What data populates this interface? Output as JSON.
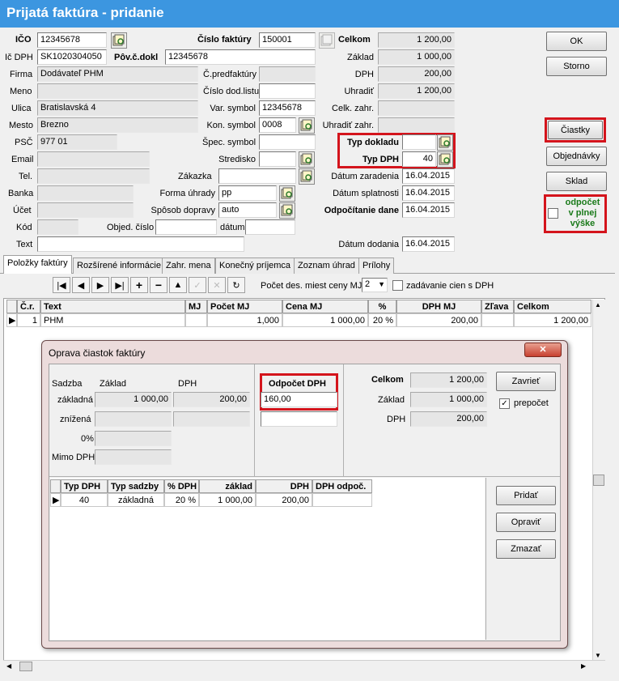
{
  "window": {
    "title": "Prijatá faktúra  -  pridanie"
  },
  "form": {
    "ico_label": "IČO",
    "ico": "12345678",
    "icdph_label": "Ič DPH",
    "icdph": "SK1020304050",
    "firma_label": "Firma",
    "firma": "Dodávateľ PHM",
    "meno_label": "Meno",
    "meno": "",
    "ulica_label": "Ulica",
    "ulica": "Bratislavská 4",
    "mesto_label": "Mesto",
    "mesto": "Brezno",
    "psc_label": "PSČ",
    "psc": "977 01",
    "email_label": "Email",
    "tel_label": "Tel.",
    "banka_label": "Banka",
    "ucet_label": "Účet",
    "kod_label": "Kód",
    "text_label": "Text",
    "cislo_faktury_label": "Číslo faktúry",
    "cislo_faktury": "150001",
    "pov_c_dokl_label": "Pôv.č.dokl",
    "pov_c_dokl": "12345678",
    "c_predfaktury_label": "Č.predfaktúry",
    "cislo_dod_listu_label": "Číslo dod.listu",
    "var_symbol_label": "Var. symbol",
    "var_symbol": "12345678",
    "kon_symbol_label": "Kon. symbol",
    "kon_symbol": "0008",
    "spec_symbol_label": "Špec. symbol",
    "stredisko_label": "Stredisko",
    "zakazka_label": "Zákazka",
    "forma_uhrady_label": "Forma úhrady",
    "forma_uhrady": "pp",
    "sposob_dopravy_label": "Spôsob dopravy",
    "sposob_dopravy": "auto",
    "objed_cislo_label": "Objed. číslo",
    "datum_label": "dátum",
    "celkom_label": "Celkom",
    "celkom": "1 200,00",
    "zaklad_label": "Základ",
    "zaklad": "1 000,00",
    "dph_label": "DPH",
    "dph": "200,00",
    "uhradit_label": "Uhradiť",
    "uhradit": "1 200,00",
    "celk_zahr_label": "Celk. zahr.",
    "uhradit_zahr_label": "Uhradiť zahr.",
    "typ_dokladu_label": "Typ dokladu",
    "typ_dokladu": "",
    "typ_dph_label": "Typ DPH",
    "typ_dph": "40",
    "datum_zaradenia_label": "Dátum zaradenia",
    "datum_zaradenia": "16.04.2015",
    "datum_splatnosti_label": "Dátum splatnosti",
    "datum_splatnosti": "16.04.2015",
    "odpocitanie_dane_label": "Odpočítanie dane",
    "odpocitanie_dane": "16.04.2015",
    "datum_dodania_label": "Dátum dodania",
    "datum_dodania": "16.04.2015"
  },
  "buttons": {
    "ok": "OK",
    "storno": "Storno",
    "ciastky": "Čiastky",
    "objednavky": "Objednávky",
    "sklad": "Sklad"
  },
  "odpocet": {
    "label_line1": "odpočet",
    "label_line2": "v plnej",
    "label_line3": "výške"
  },
  "tabs": [
    "Položky faktúry",
    "Rozšírené informácie",
    "Zahr. mena",
    "Konečný príjemca",
    "Zoznam úhrad",
    "Prílohy"
  ],
  "toolbar": {
    "pocet_des_label": "Počet des. miest ceny MJ",
    "pocet_des_value": "2",
    "zadavanie_label": "zadávanie cien s DPH"
  },
  "items_table": {
    "headers": [
      "Č.r.",
      "Text",
      "MJ",
      "Počet MJ",
      "Cena MJ",
      "%",
      "DPH MJ",
      "Zľava",
      "Celkom"
    ],
    "rows": [
      [
        "1",
        "PHM",
        "",
        "1,000",
        "1 000,00",
        "20 %",
        "200,00",
        "",
        "1 200,00"
      ]
    ]
  },
  "dialog": {
    "title": "Oprava čiastok faktúry",
    "sadzba_label": "Sadzba",
    "zaklad_label": "Základ",
    "dph_label": "DPH",
    "zakladna_label": "základná",
    "zakladna_zaklad": "1 000,00",
    "zakladna_dph": "200,00",
    "znizena_label": "znížená",
    "zero_label": "0%",
    "mimo_label": "Mimo DPH",
    "odpocet_dph_label": "Odpočet DPH",
    "odpocet_dph_value": "160,00",
    "celkom_label": "Celkom",
    "celkom": "1 200,00",
    "zaklad_r_label": "Základ",
    "zaklad_r": "1 000,00",
    "dph_r_label": "DPH",
    "dph_r": "200,00",
    "zavriet": "Zavrieť",
    "prepocet": "prepočet",
    "pridat": "Pridať",
    "opravit": "Opraviť",
    "zmazat": "Zmazať",
    "table_headers": [
      "Typ DPH",
      "Typ sadzby",
      "% DPH",
      "základ",
      "DPH",
      "DPH odpoč."
    ],
    "table_rows": [
      [
        "40",
        "základná",
        "20 %",
        "1 000,00",
        "200,00",
        ""
      ]
    ]
  },
  "colors": {
    "title_bg": "#3c96e0",
    "highlight": "#d4141c",
    "green_text": "#1a7a1a"
  }
}
